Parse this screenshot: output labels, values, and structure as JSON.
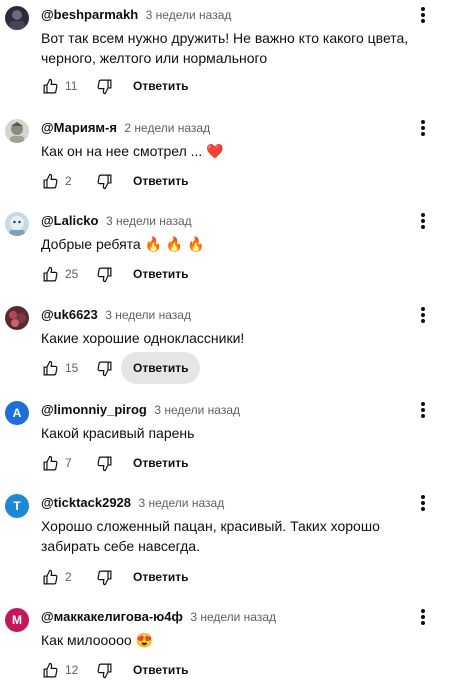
{
  "comments": [
    {
      "author": "@beshparmakh",
      "time": "3 недели назад",
      "text": "Вот так всем нужно дружить! Не важно кто какого цвета, черного, желтого или нормального",
      "likes": "11",
      "reply_label": "Ответить",
      "avatar_letter": "",
      "avatar_color": "#2b2b3a"
    },
    {
      "author": "@Мариям-я",
      "time": "2 недели назад",
      "text": "Как он на нее смотрел ... ❤️",
      "likes": "2",
      "reply_label": "Ответить",
      "avatar_letter": "",
      "avatar_color": "#b9b9b0"
    },
    {
      "author": "@Lalicko",
      "time": "3 недели назад",
      "text": "Добрые ребята 🔥 🔥 🔥",
      "likes": "25",
      "reply_label": "Ответить",
      "avatar_letter": "",
      "avatar_color": "#9fb5c8"
    },
    {
      "author": "@uk6623",
      "time": "3 недели назад",
      "text": "Какие хорошие одноклассники!",
      "likes": "15",
      "reply_label": "Ответить",
      "avatar_letter": "",
      "avatar_color": "#5a2a2e"
    },
    {
      "author": "@limonniy_pirog",
      "time": "3 недели назад",
      "text": "Какой красивый парень",
      "likes": "7",
      "reply_label": "Ответить",
      "avatar_letter": "A",
      "avatar_color": "#1e6fd9"
    },
    {
      "author": "@ticktack2928",
      "time": "3 недели назад",
      "text": "Хорошо сложенный пацан, красивый. Таких хорошо забирать себе навсегда.",
      "likes": "2",
      "reply_label": "Ответить",
      "avatar_letter": "T",
      "avatar_color": "#1c88d6"
    },
    {
      "author": "@маккакелигова-ю4ф",
      "time": "3 недели назад",
      "text": "Как милоoooo 😍",
      "likes": "12",
      "reply_label": "Ответить",
      "avatar_letter": "M",
      "avatar_color": "#c2185b"
    }
  ],
  "icons": {
    "like": "thumb-up-icon",
    "dislike": "thumb-down-icon",
    "more": "more-vertical-icon"
  }
}
